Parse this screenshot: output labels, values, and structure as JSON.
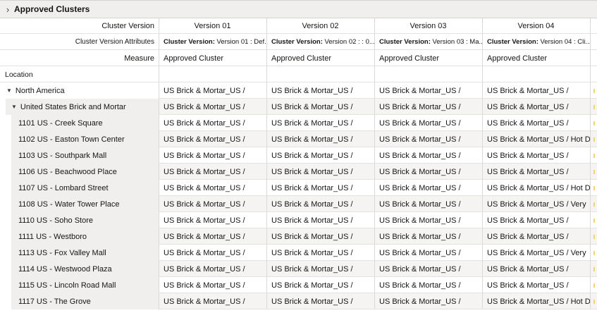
{
  "panel": {
    "title": "Approved Clusters",
    "chevron_icon": "chevron-right-icon"
  },
  "header": {
    "cluster_version_label": "Cluster Version",
    "attributes_label": "Cluster Version Attributes",
    "measure_label": "Measure",
    "location_label": "Location",
    "versions": [
      "Version 01",
      "Version 02",
      "Version 03",
      "Version 04"
    ],
    "attributes": [
      {
        "key": "Cluster Version:",
        "value": " Version 01 : Def..."
      },
      {
        "key": "Cluster Version:",
        "value": " Version 02 : : 0..."
      },
      {
        "key": "Cluster Version:",
        "value": " Version 03 : Ma..."
      },
      {
        "key": "Cluster Version:",
        "value": " Version 04 : Cli..."
      }
    ],
    "measures": [
      "Approved Cluster",
      "Approved Cluster",
      "Approved Cluster",
      "Approved Cluster"
    ]
  },
  "rows": [
    {
      "label": "North America",
      "level": 0,
      "expanded": true,
      "cells": [
        "US Brick & Mortar_US /",
        "US Brick & Mortar_US /",
        "US Brick & Mortar_US /",
        "US Brick & Mortar_US /"
      ]
    },
    {
      "label": "United States Brick and Mortar",
      "level": 1,
      "expanded": true,
      "cells": [
        "US Brick & Mortar_US /",
        "US Brick & Mortar_US /",
        "US Brick & Mortar_US /",
        "US Brick & Mortar_US /"
      ]
    },
    {
      "label": "1101 US - Creek Square",
      "level": 2,
      "cells": [
        "US Brick & Mortar_US /",
        "US Brick & Mortar_US /",
        "US Brick & Mortar_US /",
        "US Brick & Mortar_US /"
      ]
    },
    {
      "label": "1102 US - Easton Town Center",
      "level": 2,
      "cells": [
        "US Brick & Mortar_US /",
        "US Brick & Mortar_US /",
        "US Brick & Mortar_US /",
        "US Brick & Mortar_US / Hot Dry"
      ]
    },
    {
      "label": "1103 US - Southpark Mall",
      "level": 2,
      "cells": [
        "US Brick & Mortar_US /",
        "US Brick & Mortar_US /",
        "US Brick & Mortar_US /",
        "US Brick & Mortar_US /"
      ]
    },
    {
      "label": "1106 US - Beachwood Place",
      "level": 2,
      "cells": [
        "US Brick & Mortar_US /",
        "US Brick & Mortar_US /",
        "US Brick & Mortar_US /",
        "US Brick & Mortar_US /"
      ]
    },
    {
      "label": "1107 US - Lombard Street",
      "level": 2,
      "cells": [
        "US Brick & Mortar_US /",
        "US Brick & Mortar_US /",
        "US Brick & Mortar_US /",
        "US Brick & Mortar_US / Hot Dry"
      ]
    },
    {
      "label": "1108 US - Water Tower Place",
      "level": 2,
      "cells": [
        "US Brick & Mortar_US /",
        "US Brick & Mortar_US /",
        "US Brick & Mortar_US /",
        "US Brick & Mortar_US / Very"
      ]
    },
    {
      "label": "1110 US - Soho Store",
      "level": 2,
      "cells": [
        "US Brick & Mortar_US /",
        "US Brick & Mortar_US /",
        "US Brick & Mortar_US /",
        "US Brick & Mortar_US /"
      ]
    },
    {
      "label": "1111 US - Westboro",
      "level": 2,
      "cells": [
        "US Brick & Mortar_US /",
        "US Brick & Mortar_US /",
        "US Brick & Mortar_US /",
        "US Brick & Mortar_US /"
      ]
    },
    {
      "label": "1113 US - Fox Valley Mall",
      "level": 2,
      "cells": [
        "US Brick & Mortar_US /",
        "US Brick & Mortar_US /",
        "US Brick & Mortar_US /",
        "US Brick & Mortar_US / Very"
      ]
    },
    {
      "label": "1114 US - Westwood Plaza",
      "level": 2,
      "cells": [
        "US Brick & Mortar_US /",
        "US Brick & Mortar_US /",
        "US Brick & Mortar_US /",
        "US Brick & Mortar_US /"
      ]
    },
    {
      "label": "1115 US - Lincoln Road Mall",
      "level": 2,
      "cells": [
        "US Brick & Mortar_US /",
        "US Brick & Mortar_US /",
        "US Brick & Mortar_US /",
        "US Brick & Mortar_US /"
      ]
    },
    {
      "label": "1117 US - The Grove",
      "level": 2,
      "cells": [
        "US Brick & Mortar_US /",
        "US Brick & Mortar_US /",
        "US Brick & Mortar_US /",
        "US Brick & Mortar_US / Hot Dry"
      ]
    }
  ],
  "colors": {
    "header_bg": "#f1efed",
    "row_shade": "#f5f4f2",
    "grid_line": "#dcd9d5"
  }
}
